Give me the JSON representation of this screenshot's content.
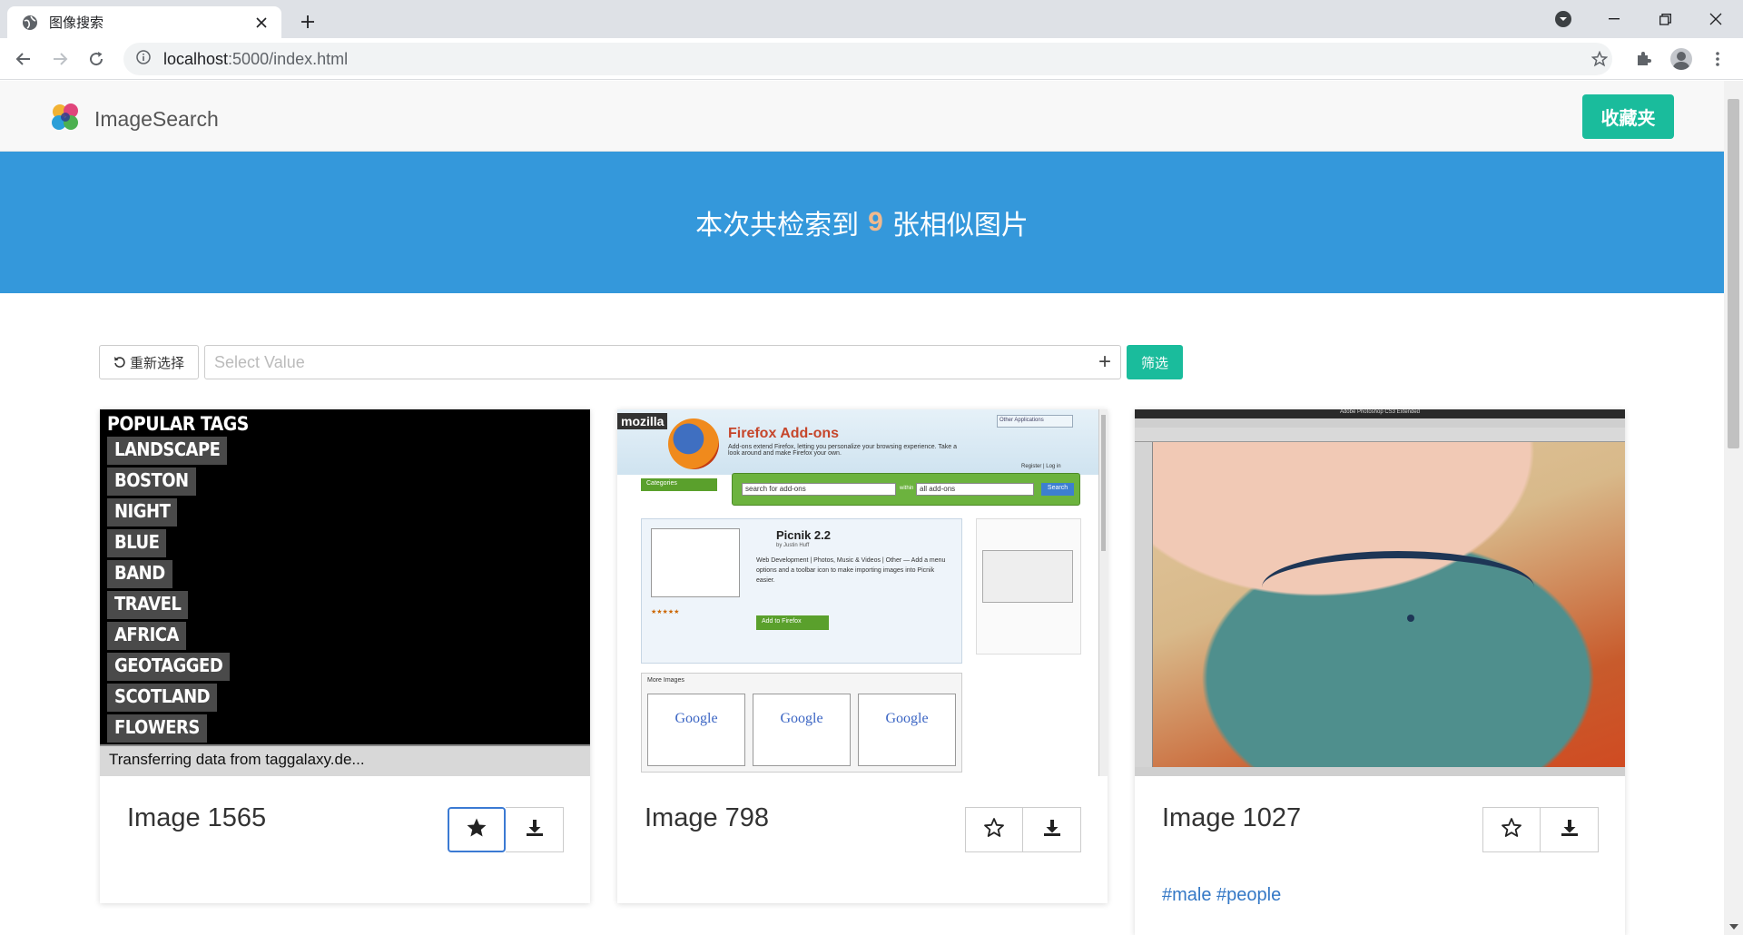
{
  "browser": {
    "tab_title": "图像搜索",
    "url_host": "localhost",
    "url_rest": ":5000/index.html"
  },
  "navbar": {
    "brand": "ImageSearch",
    "favorites_button": "收藏夹"
  },
  "hero": {
    "prefix": "本次共检索到",
    "count": "9",
    "suffix": "张相似图片"
  },
  "filter": {
    "reset_label": "重新选择",
    "select_placeholder": "Select Value",
    "add_symbol": "+",
    "filter_label": "筛选"
  },
  "cards": [
    {
      "title": "Image 1565",
      "favorited": true,
      "tags": "",
      "thumb": {
        "heading": "POPULAR TAGS",
        "tags": [
          "LANDSCAPE",
          "BOSTON",
          "NIGHT",
          "BLUE",
          "BAND",
          "TRAVEL",
          "AFRICA",
          "GEOTAGGED",
          "SCOTLAND",
          "FLOWERS"
        ],
        "status": "Transferring data from taggalaxy.de..."
      }
    },
    {
      "title": "Image 798",
      "favorited": false,
      "tags": "",
      "thumb": {
        "badge": "mozilla",
        "heading": "Firefox Add-ons",
        "subtitle": "Add-ons extend Firefox, letting you personalize your browsing experience. Take a look around and make Firefox your own.",
        "other_apps": "Other Applications",
        "register": "Register | Log in",
        "categories": "Categories",
        "search_placeholder": "search for add-ons",
        "within": "within",
        "scope": "all add-ons",
        "search_button": "Search",
        "addon_name": "Picnik 2.2",
        "addon_by": "by Justin Huff",
        "addon_desc": "Web Development | Photos, Music & Videos | Other — Add a menu options and a toolbar icon to make importing images into Picnik easier.",
        "add_button": "Add to Firefox",
        "more_images": "More Images",
        "google": "Google"
      }
    },
    {
      "title": "Image 1027",
      "favorited": false,
      "tags": "#male #people",
      "thumb": {
        "window_title": "Adobe Photoshop CS3 Extended"
      }
    }
  ],
  "colors": {
    "accent": "#1abc9c",
    "hero_bg": "#3498db",
    "count_color": "#f0b98d",
    "tag_link": "#3478c6"
  }
}
